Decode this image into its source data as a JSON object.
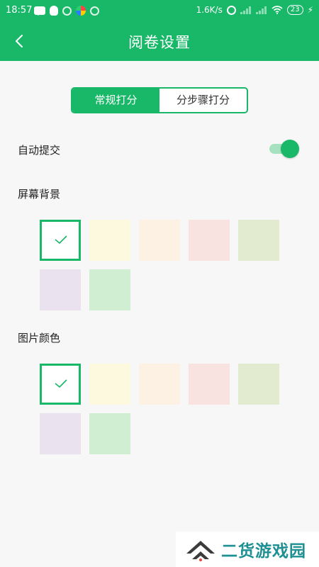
{
  "status_bar": {
    "time": "18:57",
    "network_speed": "1.6K/s",
    "battery": "23"
  },
  "header": {
    "title": "阅卷设置"
  },
  "tabs": [
    {
      "label": "常规打分",
      "active": true
    },
    {
      "label": "分步骤打分",
      "active": false
    }
  ],
  "settings": {
    "auto_submit": {
      "label": "自动提交",
      "enabled": true
    },
    "screen_background": {
      "label": "屏幕背景",
      "selected_index": 0,
      "swatches": [
        "#ffffff",
        "#fdf9df",
        "#fdf1e4",
        "#f9e3e1",
        "#e2eacf",
        "#ebe2f0",
        "#d0eed1"
      ]
    },
    "image_color": {
      "label": "图片颜色",
      "selected_index": 0,
      "swatches": [
        "#ffffff",
        "#fdf9df",
        "#fdf1e4",
        "#f9e3e1",
        "#e2eacf",
        "#ebe2f0",
        "#d0eed1"
      ]
    }
  },
  "watermark": {
    "text": "二货游戏园"
  },
  "colors": {
    "accent": "#19b868",
    "accent_light": "#a6e2c0",
    "background": "#f7f7f7"
  }
}
